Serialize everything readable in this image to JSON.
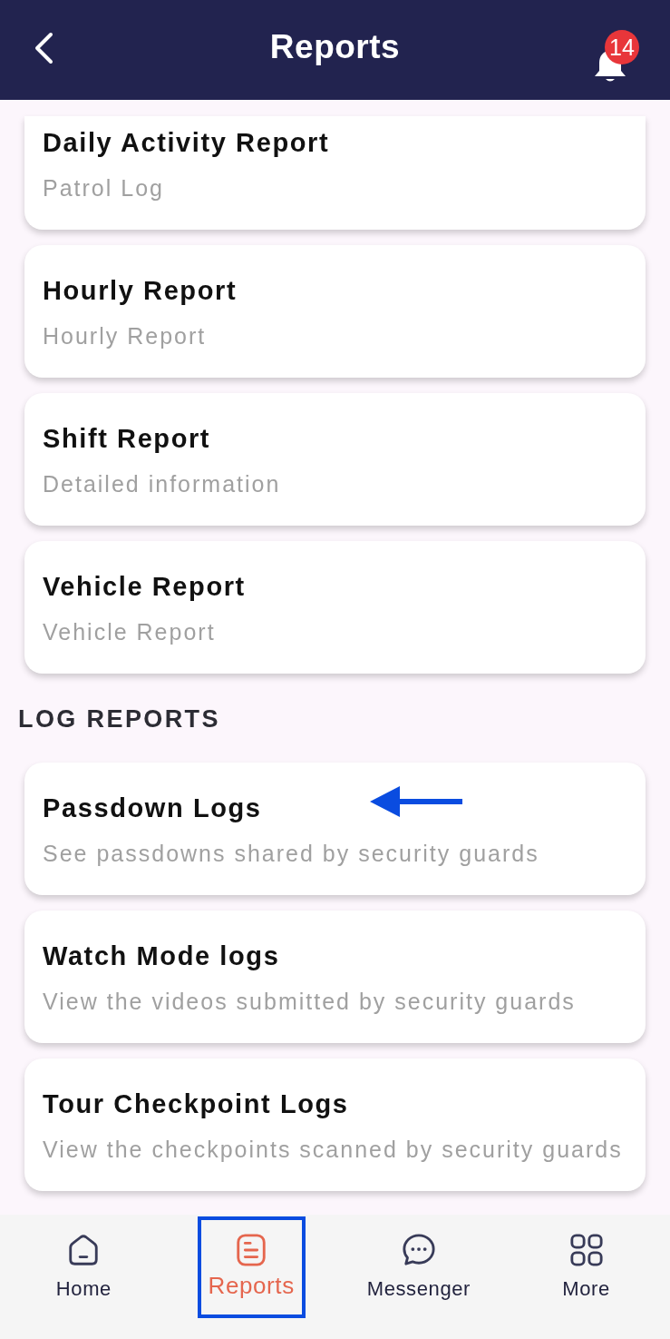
{
  "header": {
    "title": "Reports",
    "notification_count": "14"
  },
  "report_cards": [
    {
      "title": "Daily Activity Report",
      "subtitle": "Patrol Log",
      "arrow": false
    },
    {
      "title": "Hourly Report",
      "subtitle": "Hourly Report",
      "arrow": false
    },
    {
      "title": "Shift Report",
      "subtitle": "Detailed information",
      "arrow": false
    },
    {
      "title": "Vehicle Report",
      "subtitle": "Vehicle Report",
      "arrow": false
    }
  ],
  "log_section": {
    "heading": "LOG REPORTS",
    "cards": [
      {
        "title": "Passdown Logs",
        "subtitle": "See passdowns shared by security guards",
        "arrow": true
      },
      {
        "title": "Watch Mode logs",
        "subtitle": "View the videos submitted by security guards",
        "arrow": false
      },
      {
        "title": "Tour Checkpoint Logs",
        "subtitle": "View the checkpoints scanned by security guards",
        "arrow": false
      }
    ]
  },
  "bottom_nav": [
    {
      "kind": "home",
      "label": "Home",
      "selected": false,
      "framed": false
    },
    {
      "kind": "reports",
      "label": "Reports",
      "selected": true,
      "framed": true
    },
    {
      "kind": "messenger",
      "label": "Messenger",
      "selected": false,
      "framed": false
    },
    {
      "kind": "more",
      "label": "More",
      "selected": false,
      "framed": false
    }
  ]
}
